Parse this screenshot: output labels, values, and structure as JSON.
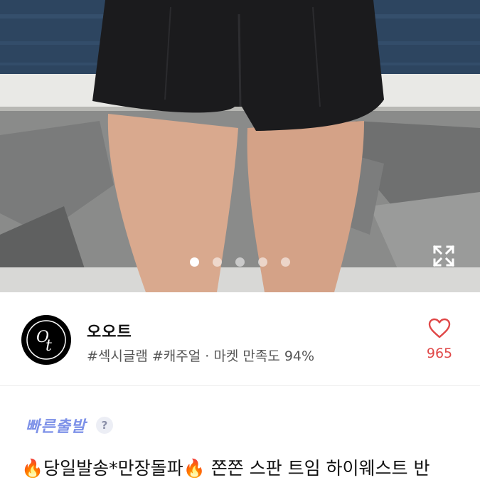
{
  "hero": {
    "image_description": "",
    "pager": {
      "total": 5,
      "active_index": 0
    },
    "expand_icon": "expand-icon"
  },
  "seller": {
    "name": "오오트",
    "tags": "#섹시글램 #캐주얼 · 마켓 만족도 94%",
    "avatar_icon": "ot-logo-icon",
    "like_count": "965",
    "like_icon": "heart-outline-icon"
  },
  "badge": {
    "label": "빠른출발",
    "help_glyph": "?"
  },
  "product": {
    "title": "🔥당일발송*만장돌파🔥 쫀쫀 스판 트임 하이웨스트 반"
  },
  "colors": {
    "accent_like": "#e04848",
    "badge": "#7d91e8"
  }
}
